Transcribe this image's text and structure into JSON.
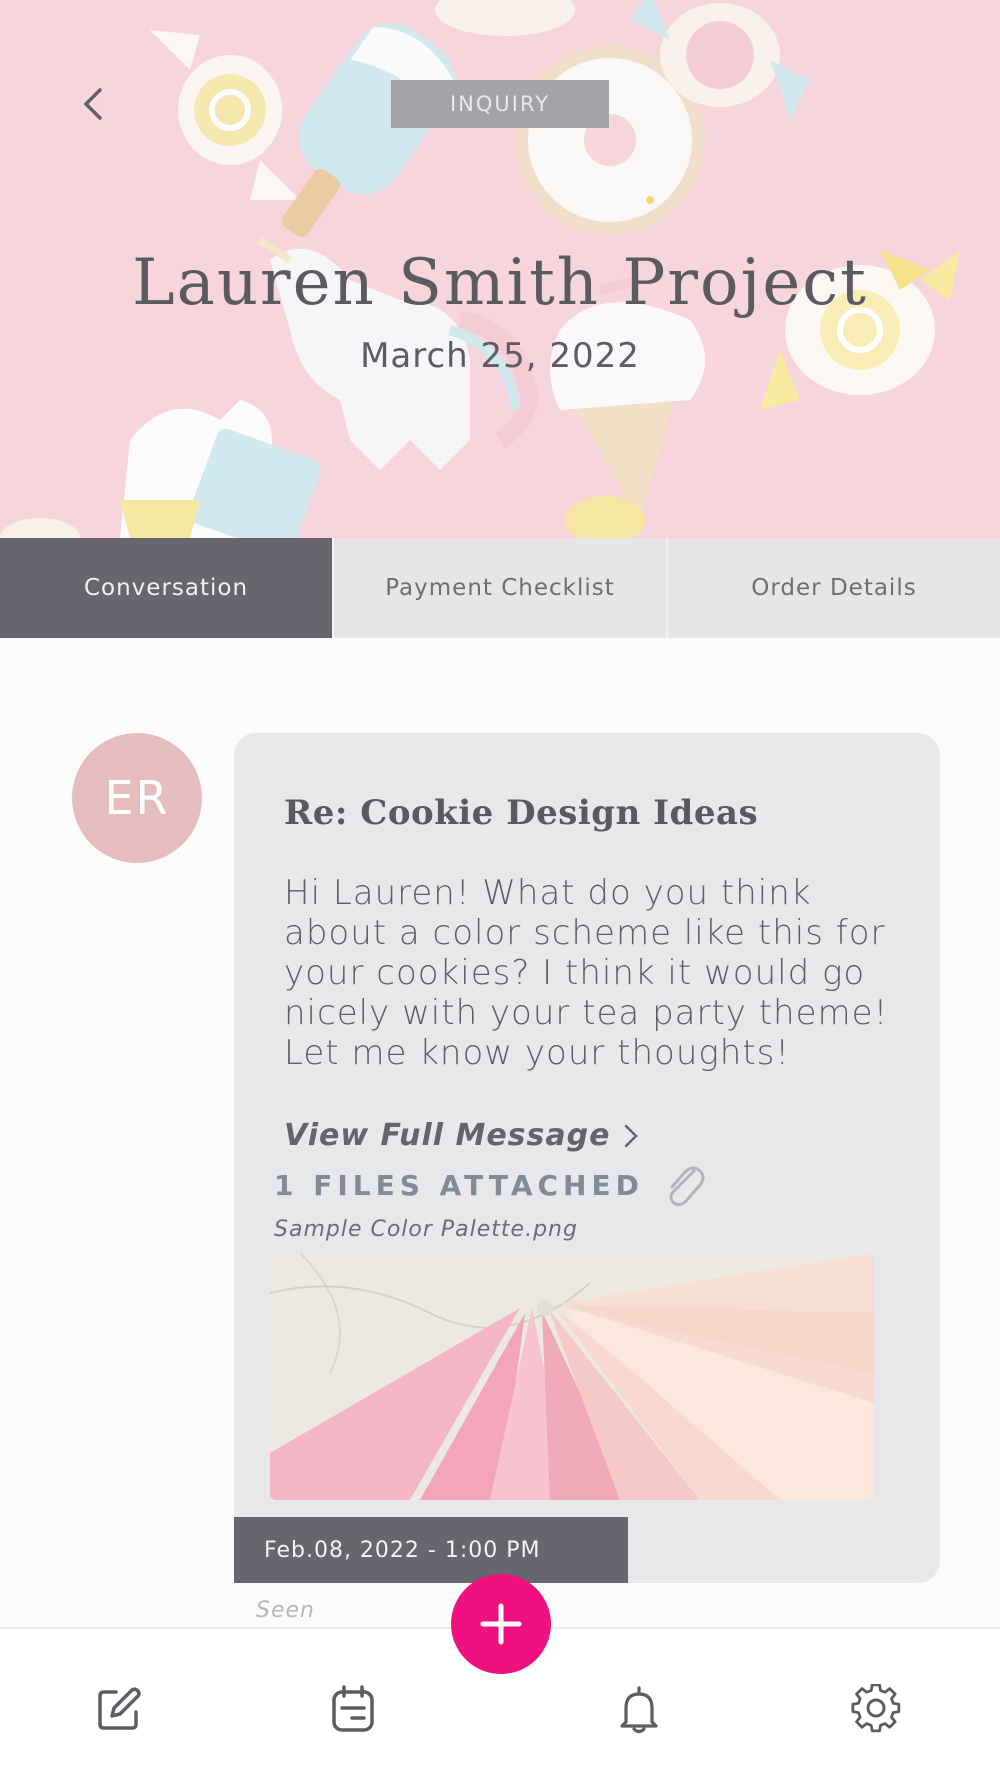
{
  "header": {
    "status_badge": "INQUIRY",
    "title": "Lauren Smith Project",
    "date": "March 25, 2022"
  },
  "tabs": [
    {
      "label": "Conversation",
      "active": true
    },
    {
      "label": "Payment Checklist",
      "active": false
    },
    {
      "label": "Order Details",
      "active": false
    }
  ],
  "message": {
    "avatar_initials": "ER",
    "subject": "Re: Cookie Design Ideas",
    "body": "Hi Lauren! What do you think about a color scheme like this for your cookies? I think it would go nicely with your tea party theme! Let me know your thoughts!",
    "view_full_label": "View Full Message",
    "files_attached_label": "1 FILES ATTACHED",
    "attachment_name": "Sample Color Palette.png",
    "timestamp": "Feb.08, 2022 - 1:00 PM",
    "status": "Seen"
  },
  "bottom_nav": {
    "items": [
      "compose-icon",
      "calendar-icon",
      "bell-icon",
      "settings-icon"
    ],
    "fab_icon": "plus-icon"
  },
  "colors": {
    "accent": "#f0107f",
    "tab_active": "#67656d",
    "avatar": "#e6bdbf",
    "hero_bg": "#f6d3dc"
  }
}
